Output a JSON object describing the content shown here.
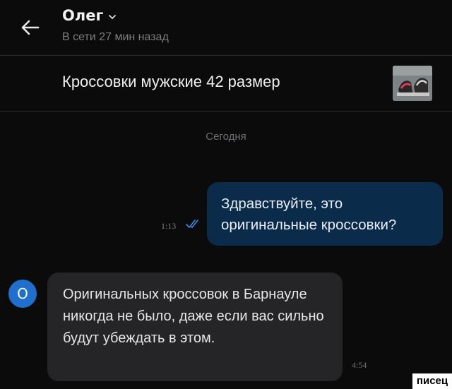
{
  "header": {
    "contact_name": "Олег",
    "status": "В сети 27 мин назад",
    "icons": {
      "back": "arrow-left-icon",
      "expand": "chevron-down-icon"
    }
  },
  "listing": {
    "title": "Кроссовки мужские 42 размер",
    "thumbnail": "sneakers-photo"
  },
  "chat": {
    "date_separator": "Сегодня",
    "messages": [
      {
        "direction": "outgoing",
        "text": "Здравствуйте, это оригинальные кроссовки?",
        "time": "1:13",
        "read_icon": "double-check-icon"
      },
      {
        "direction": "incoming",
        "avatar_letter": "О",
        "text": "Оригинальных кроссовок в Барнауле никогда не было, даже если вас сильно будут убеждать в этом.",
        "time": "4:54"
      }
    ]
  },
  "watermark": "писец",
  "colors": {
    "background": "#0b0b0c",
    "outgoing_bubble": "#0b2b4a",
    "incoming_bubble": "#252527",
    "avatar": "#1f6fcf",
    "read_check": "#3a8ee6"
  }
}
